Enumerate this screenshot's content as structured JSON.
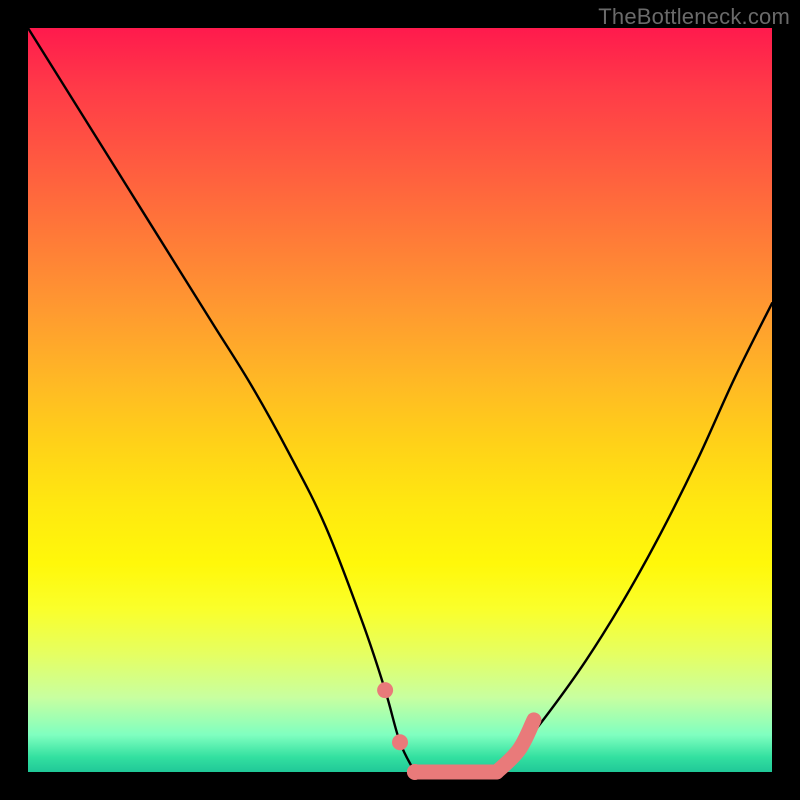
{
  "watermark": "TheBottleneck.com",
  "chart_data": {
    "type": "line",
    "title": "",
    "xlabel": "",
    "ylabel": "",
    "xlim": [
      0,
      100
    ],
    "ylim": [
      0,
      100
    ],
    "legend": false,
    "grid": false,
    "series": [
      {
        "name": "left-branch",
        "x": [
          0,
          5,
          10,
          15,
          20,
          25,
          30,
          35,
          40,
          45,
          48,
          50,
          52
        ],
        "y": [
          100,
          92,
          84,
          76,
          68,
          60,
          52,
          43,
          33,
          20,
          11,
          4,
          0
        ]
      },
      {
        "name": "flat-trough",
        "x": [
          52,
          56,
          60,
          63
        ],
        "y": [
          0,
          0,
          0,
          0
        ]
      },
      {
        "name": "right-branch",
        "x": [
          63,
          66,
          70,
          75,
          80,
          85,
          90,
          95,
          100
        ],
        "y": [
          0,
          3,
          8,
          15,
          23,
          32,
          42,
          53,
          63
        ]
      },
      {
        "name": "pink-highlight",
        "x": [
          48,
          50,
          52,
          56,
          60,
          63,
          66,
          68
        ],
        "y": [
          11,
          4,
          0,
          0,
          0,
          0,
          3,
          7
        ]
      }
    ],
    "annotations": []
  },
  "colors": {
    "background": "#000000",
    "curve": "#000000",
    "highlight": "#e97a7a",
    "gradient_top": "#ff1a4d",
    "gradient_bottom": "#20c898"
  }
}
